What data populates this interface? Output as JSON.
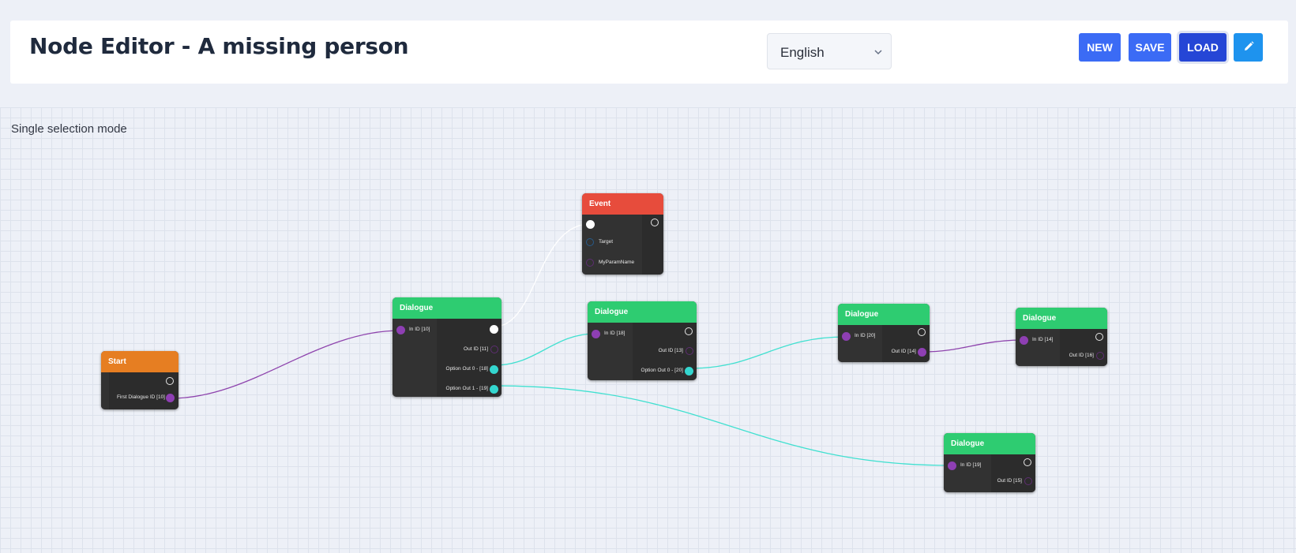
{
  "header": {
    "title": "Node Editor - A missing person",
    "language": "English",
    "buttons": {
      "new": "NEW",
      "save": "SAVE",
      "load": "LOAD"
    }
  },
  "canvas": {
    "mode_text": "Single selection mode"
  },
  "colors": {
    "start": "#e67e22",
    "dialogue": "#2ecc71",
    "event": "#e74c3c",
    "link_purple": "#8e44ad",
    "link_cyan": "#40e0d0",
    "link_white": "#ffffff",
    "btn_primary": "#3b6bf5",
    "btn_active": "#2546d6",
    "btn_edit": "#1e93ee"
  },
  "nodes": {
    "start": {
      "title": "Start",
      "out1": "First Dialogue ID [10]"
    },
    "dlg10": {
      "title": "Dialogue",
      "in": "In ID [10]",
      "out1": "Out ID [11]",
      "out2": "Option Out 0 - [18]",
      "out3": "Option Out 1 - [19]"
    },
    "event": {
      "title": "Event",
      "in1": "Target",
      "in2": "MyParamName"
    },
    "dlg18": {
      "title": "Dialogue",
      "in": "In ID [18]",
      "out1": "Out ID [13]",
      "out2": "Option Out 0 - [20]"
    },
    "dlg20": {
      "title": "Dialogue",
      "in": "In ID [20]",
      "out1": "Out ID [14]"
    },
    "dlg14": {
      "title": "Dialogue",
      "in": "In ID [14]",
      "out1": "Out ID [16]"
    },
    "dlg19": {
      "title": "Dialogue",
      "in": "In ID [19]",
      "out1": "Out ID [15]"
    }
  }
}
